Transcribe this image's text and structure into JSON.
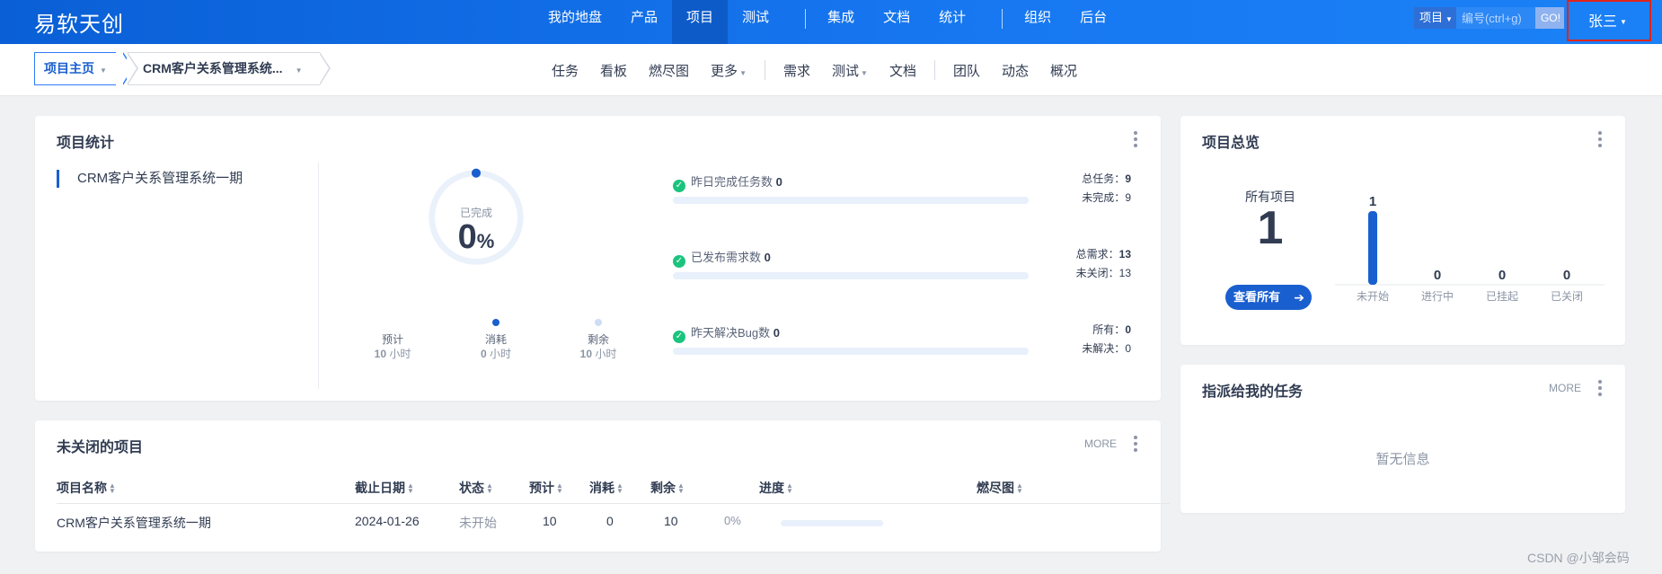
{
  "app": {
    "logo": "易软天创"
  },
  "main_nav": {
    "items": [
      "我的地盘",
      "产品",
      "项目",
      "测试",
      "集成",
      "文档",
      "统计",
      "组织",
      "后台"
    ],
    "active": "项目"
  },
  "search": {
    "type": "项目",
    "placeholder": "编号(ctrl+g)",
    "go": "GO!"
  },
  "user": {
    "name": "张三"
  },
  "breadcrumb": {
    "home": "项目主页",
    "project": "CRM客户关系管理系统..."
  },
  "sub_nav": {
    "items": [
      "任务",
      "看板",
      "燃尽图",
      "更多",
      "需求",
      "测试",
      "文档",
      "团队",
      "动态",
      "概况"
    ]
  },
  "stats_card": {
    "title": "项目统计",
    "project": "CRM客户关系管理系统一期",
    "donut": {
      "label": "已完成",
      "value": "0",
      "unit": "%",
      "percent": 0,
      "track_color": "#eaf1fb",
      "dot_color": "#1a5fcf"
    },
    "hours": [
      {
        "label": "预计",
        "value": "10",
        "unit": "小时",
        "dot_color": "transparent"
      },
      {
        "label": "消耗",
        "value": "0",
        "unit": "小时",
        "dot_color": "#1a5fcf"
      },
      {
        "label": "剩余",
        "value": "10",
        "unit": "小时",
        "dot_color": "#cdddf3"
      }
    ],
    "metrics": [
      {
        "label": "昨日完成任务数",
        "value": "0",
        "r1_label": "总任务：",
        "r1_value": "9",
        "r2_label": "未完成：",
        "r2_value": "9"
      },
      {
        "label": "已发布需求数",
        "value": "0",
        "r1_label": "总需求：",
        "r1_value": "13",
        "r2_label": "未关闭：",
        "r2_value": "13"
      },
      {
        "label": "昨天解决Bug数",
        "value": "0",
        "r1_label": "所有：",
        "r1_value": "0",
        "r2_label": "未解决：",
        "r2_value": "0"
      }
    ]
  },
  "overview_card": {
    "title": "项目总览",
    "all_label": "所有项目",
    "all_count": "1",
    "view_all": "查看所有",
    "bar_color": "#1a5fcf",
    "bars": [
      {
        "label": "未开始",
        "value": 1
      },
      {
        "label": "进行中",
        "value": 0
      },
      {
        "label": "已挂起",
        "value": 0
      },
      {
        "label": "已关闭",
        "value": 0
      }
    ]
  },
  "open_projects": {
    "title": "未关闭的项目",
    "more": "MORE",
    "columns": [
      "项目名称",
      "截止日期",
      "状态",
      "预计",
      "消耗",
      "剩余",
      "进度",
      "燃尽图"
    ],
    "rows": [
      {
        "name": "CRM客户关系管理系统一期",
        "deadline": "2024-01-26",
        "status": "未开始",
        "estimate": "10",
        "consumed": "0",
        "left": "10",
        "progress": "0%"
      }
    ]
  },
  "my_tasks": {
    "title": "指派给我的任务",
    "more": "MORE",
    "empty": "暂无信息"
  },
  "watermark": "CSDN @小邹会码"
}
